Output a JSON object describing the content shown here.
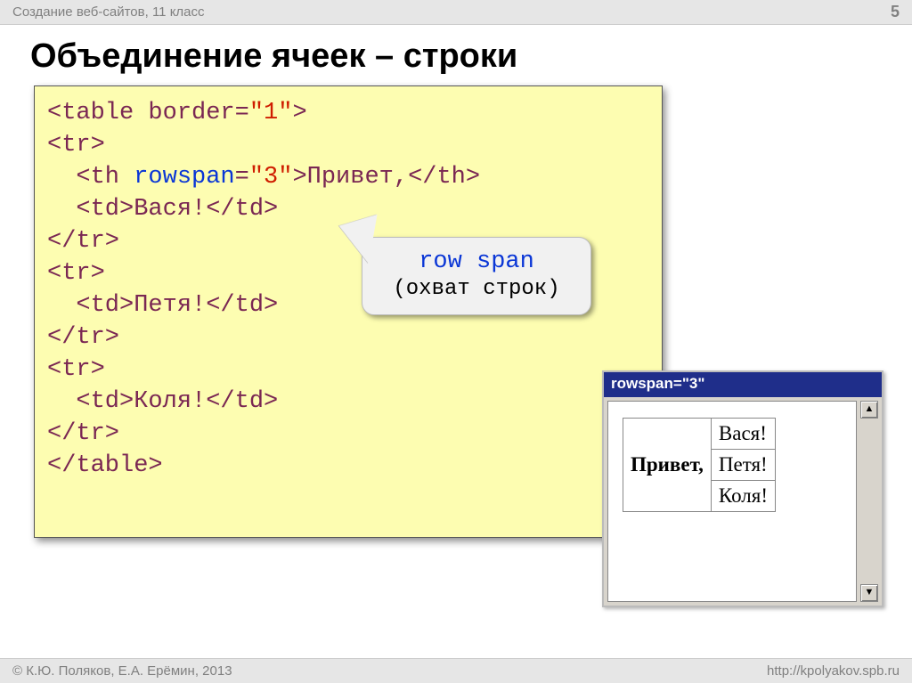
{
  "header": {
    "subject": "Создание веб-сайтов, 11 класс",
    "page_no": "5"
  },
  "title": "Объединение ячеек – строки",
  "code": {
    "l0a": "<table border=",
    "l0v": "\"1\"",
    "l0b": ">",
    "l1": "<tr>",
    "l2a": "  <th ",
    "l2n": "rowspan",
    "l2e": "=",
    "l2v": "\"3\"",
    "l2b": ">Привет,</th>",
    "l3": "  <td>Вася!</td>",
    "l4": "</tr>",
    "l5": "<tr>",
    "l6": "  <td>Петя!</td>",
    "l7": "</tr>",
    "l8": "<tr>",
    "l9": "  <td>Коля!</td>",
    "l10": "</tr>",
    "l11": "</table>"
  },
  "callout": {
    "l1": "row span",
    "l2": "(охват строк)"
  },
  "browser": {
    "title": "rowspan=\"3\"",
    "th": "Привет,",
    "r1": "Вася!",
    "r2": "Петя!",
    "r3": "Коля!"
  },
  "footer": {
    "left": "© К.Ю. Поляков, Е.А. Ерёмин, 2013",
    "right": "http://kpolyakov.spb.ru"
  }
}
